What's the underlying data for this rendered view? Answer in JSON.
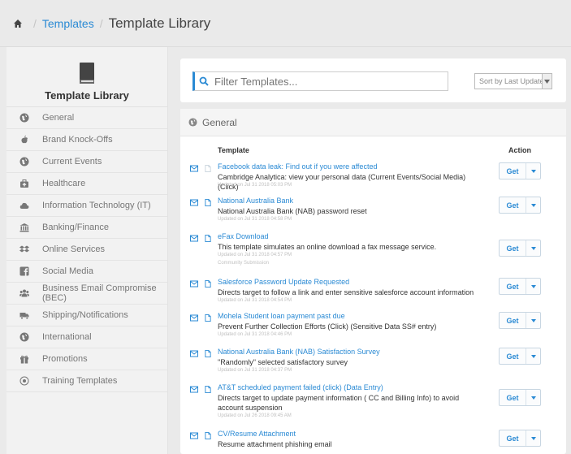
{
  "breadcrumb": {
    "home_icon": "home-icon",
    "parent": "Templates",
    "current": "Template Library"
  },
  "sidebar": {
    "title": "Template Library",
    "header_icon": "book-icon",
    "items": [
      {
        "label": "General",
        "icon": "globe-icon"
      },
      {
        "label": "Brand Knock-Offs",
        "icon": "apple-icon"
      },
      {
        "label": "Current Events",
        "icon": "globe-icon"
      },
      {
        "label": "Healthcare",
        "icon": "medkit-icon"
      },
      {
        "label": "Information Technology (IT)",
        "icon": "cloud-icon"
      },
      {
        "label": "Banking/Finance",
        "icon": "bank-icon"
      },
      {
        "label": "Online Services",
        "icon": "dropbox-icon"
      },
      {
        "label": "Social Media",
        "icon": "facebook-icon"
      },
      {
        "label": "Business Email Compromise (BEC)",
        "icon": "users-icon"
      },
      {
        "label": "Shipping/Notifications",
        "icon": "truck-icon"
      },
      {
        "label": "International",
        "icon": "globe-icon"
      },
      {
        "label": "Promotions",
        "icon": "gift-icon"
      },
      {
        "label": "Training Templates",
        "icon": "target-icon"
      }
    ]
  },
  "filter": {
    "placeholder": "Filter Templates...",
    "sort_label": "Sort by Last Updated"
  },
  "list": {
    "section_title": "General",
    "col_template": "Template",
    "col_action": "Action",
    "get_label": "Get",
    "rows": [
      {
        "title": "Facebook data leak: Find out if you were affected",
        "desc": "Cambridge Analytica: view your personal data (Current Events/Social Media) (Click)",
        "meta": "Updated on Jul 31 2018 05:03 PM",
        "extra": ""
      },
      {
        "title": "National Australia Bank",
        "desc": "National Australia Bank (NAB) password reset",
        "meta": "Updated on Jul 31 2018 04:58 PM",
        "extra": ""
      },
      {
        "title": "eFax Download",
        "desc": "This template simulates an online download a fax message service.",
        "meta": "Updated on Jul 31 2018 04:57 PM",
        "extra": "Community Submission"
      },
      {
        "title": "Salesforce Password Update Requested",
        "desc": "Directs target to follow a link and enter sensitive salesforce account information",
        "meta": "Updated on Jul 31 2018 04:54 PM",
        "extra": ""
      },
      {
        "title": "Mohela Student loan payment past due",
        "desc": "Prevent Further Collection Efforts (Click) (Sensitive Data SS# entry)",
        "meta": "Updated on Jul 31 2018 04:46 PM",
        "extra": ""
      },
      {
        "title": "National Australia Bank (NAB) Satisfaction Survey",
        "desc": "\"Randomly\" selected satisfactory survey",
        "meta": "Updated on Jul 31 2018 04:37 PM",
        "extra": ""
      },
      {
        "title": "AT&T scheduled payment failed (click) (Data Entry)",
        "desc": "Directs target to update payment information ( CC and Billing Info) to avoid account suspension",
        "meta": "Updated on Jul 26 2018 09:45 AM",
        "extra": ""
      },
      {
        "title": "CV/Resume Attachment",
        "desc": "Resume attachment phishing email",
        "meta": "",
        "extra": ""
      }
    ]
  },
  "colors": {
    "accent": "#2a8ad4",
    "sidebar_bg": "#f2f2f2",
    "page_bg": "#eaeaea"
  }
}
